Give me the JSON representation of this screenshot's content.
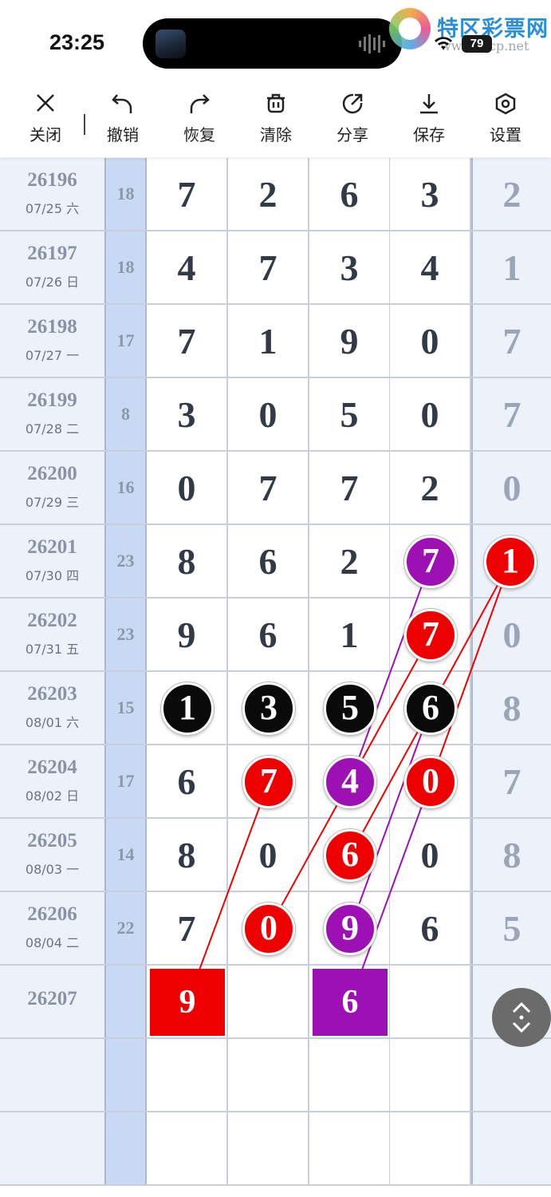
{
  "status_bar": {
    "time": "23:25",
    "battery": "79"
  },
  "watermark": {
    "title": "特区彩票网",
    "url": "www.tqcp.net"
  },
  "toolbar": {
    "items": [
      {
        "label": "关闭",
        "icon": "close-icon"
      },
      {
        "label": "撤销",
        "icon": "undo-icon"
      },
      {
        "label": "恢复",
        "icon": "redo-icon"
      },
      {
        "label": "清除",
        "icon": "clear-icon"
      },
      {
        "label": "分享",
        "icon": "share-icon"
      },
      {
        "label": "保存",
        "icon": "save-icon"
      },
      {
        "label": "设置",
        "icon": "settings-icon"
      }
    ]
  },
  "rows": [
    {
      "issue": "26196",
      "date": "07/25 六",
      "sum": "18",
      "digits": [
        "7",
        "2",
        "6",
        "3"
      ],
      "last": "2"
    },
    {
      "issue": "26197",
      "date": "07/26 日",
      "sum": "18",
      "digits": [
        "4",
        "7",
        "3",
        "4"
      ],
      "last": "1"
    },
    {
      "issue": "26198",
      "date": "07/27 一",
      "sum": "17",
      "digits": [
        "7",
        "1",
        "9",
        "0"
      ],
      "last": "7"
    },
    {
      "issue": "26199",
      "date": "07/28 二",
      "sum": "8",
      "digits": [
        "3",
        "0",
        "5",
        "0"
      ],
      "last": "7"
    },
    {
      "issue": "26200",
      "date": "07/29 三",
      "sum": "16",
      "digits": [
        "0",
        "7",
        "7",
        "2"
      ],
      "last": "0"
    },
    {
      "issue": "26201",
      "date": "07/30 四",
      "sum": "23",
      "digits": [
        "8",
        "6",
        "2",
        "7"
      ],
      "last": "1"
    },
    {
      "issue": "26202",
      "date": "07/31 五",
      "sum": "23",
      "digits": [
        "9",
        "6",
        "1",
        "7"
      ],
      "last": "0"
    },
    {
      "issue": "26203",
      "date": "08/01 六",
      "sum": "15",
      "digits": [
        "1",
        "3",
        "5",
        "6"
      ],
      "last": "8"
    },
    {
      "issue": "26204",
      "date": "08/02 日",
      "sum": "17",
      "digits": [
        "6",
        "7",
        "4",
        "0"
      ],
      "last": "7"
    },
    {
      "issue": "26205",
      "date": "08/03 一",
      "sum": "14",
      "digits": [
        "8",
        "0",
        "6",
        "0"
      ],
      "last": "8"
    },
    {
      "issue": "26206",
      "date": "08/04 二",
      "sum": "22",
      "digits": [
        "7",
        "0",
        "9",
        "6"
      ],
      "last": "5"
    },
    {
      "issue": "26207",
      "date": "",
      "sum": "",
      "digits": [
        "9",
        "",
        "6",
        ""
      ],
      "last": ""
    },
    {
      "issue": "",
      "date": "",
      "sum": "",
      "digits": [
        "",
        "",
        "",
        ""
      ],
      "last": ""
    },
    {
      "issue": "",
      "date": "",
      "sum": "",
      "digits": [
        "",
        "",
        "",
        ""
      ],
      "last": ""
    }
  ],
  "marks": [
    {
      "row": 5,
      "col": 3,
      "style": "purple"
    },
    {
      "row": 5,
      "col": 4,
      "style": "red"
    },
    {
      "row": 6,
      "col": 3,
      "style": "red"
    },
    {
      "row": 7,
      "col": 0,
      "style": "black"
    },
    {
      "row": 7,
      "col": 1,
      "style": "black"
    },
    {
      "row": 7,
      "col": 2,
      "style": "black"
    },
    {
      "row": 7,
      "col": 3,
      "style": "black"
    },
    {
      "row": 8,
      "col": 1,
      "style": "red"
    },
    {
      "row": 8,
      "col": 2,
      "style": "purple"
    },
    {
      "row": 8,
      "col": 3,
      "style": "red"
    },
    {
      "row": 9,
      "col": 2,
      "style": "red"
    },
    {
      "row": 10,
      "col": 1,
      "style": "red"
    },
    {
      "row": 10,
      "col": 2,
      "style": "purple"
    },
    {
      "row": 11,
      "col": 0,
      "style": "red-square"
    },
    {
      "row": 11,
      "col": 2,
      "style": "purple-square"
    }
  ],
  "colors": {
    "red": "#ee0000",
    "purple": "#9c10b4",
    "black": "#0a0a0a"
  },
  "fab_icon": "scroll-toggle-icon"
}
